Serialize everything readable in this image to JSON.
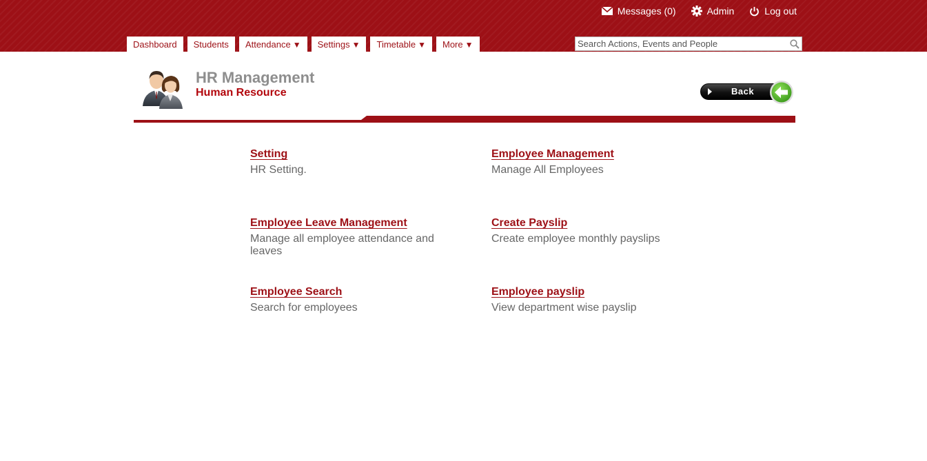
{
  "header": {
    "user_links": [
      {
        "label": "Messages (0)",
        "icon": "envelope-icon"
      },
      {
        "label": "Admin",
        "icon": "gear-icon"
      },
      {
        "label": "Log out",
        "icon": "power-icon"
      }
    ],
    "nav": [
      {
        "label": "Dashboard",
        "dropdown": false
      },
      {
        "label": "Students",
        "dropdown": false
      },
      {
        "label": "Attendance",
        "dropdown": true
      },
      {
        "label": "Settings",
        "dropdown": true
      },
      {
        "label": "Timetable",
        "dropdown": true
      },
      {
        "label": "More",
        "dropdown": true
      }
    ],
    "dropdown_caret": "▼",
    "search": {
      "placeholder": "Search Actions, Events and People",
      "value": "",
      "icon": "search-icon"
    }
  },
  "page": {
    "title": "HR Management",
    "subtitle": "Human Resource",
    "icon": "users-icon",
    "back_label": "Back",
    "back_icon": "arrow-left-icon"
  },
  "cards": [
    {
      "title": "Setting",
      "description": "HR Setting."
    },
    {
      "title": "Employee Management",
      "description": "Manage All Employees"
    },
    {
      "title": "Employee Leave Management",
      "description": "Manage all employee attendance and leaves"
    },
    {
      "title": "Create Payslip",
      "description": "Create employee monthly payslips"
    },
    {
      "title": "Employee Search",
      "description": "Search for employees"
    },
    {
      "title": "Employee payslip",
      "description": "View department wise payslip"
    }
  ],
  "colors": {
    "brand_red": "#9d1016",
    "subtitle_red": "#b3070d",
    "title_gray": "#8e8e8e",
    "text_gray": "#666666",
    "back_green": "#5cb82e"
  }
}
